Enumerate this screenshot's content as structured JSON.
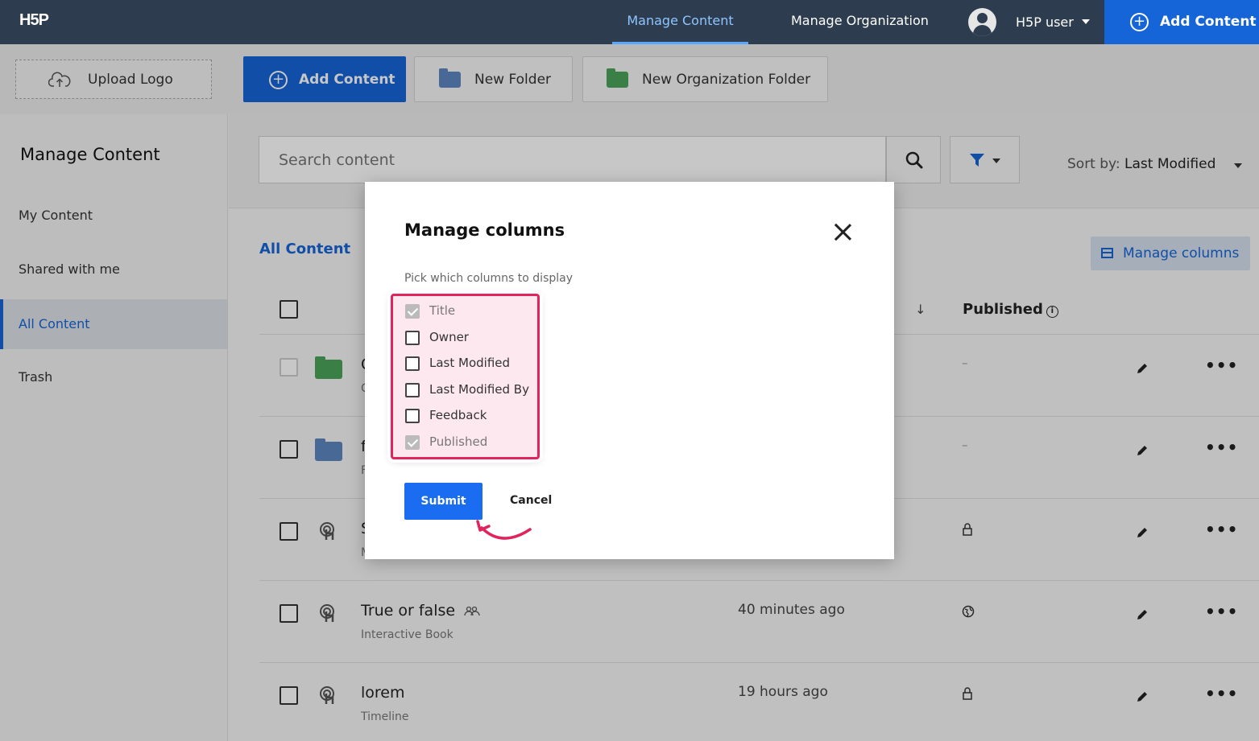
{
  "topbar": {
    "logo": "H5P",
    "nav": [
      "Manage Content",
      "Manage Organization"
    ],
    "user_name": "H5P user",
    "add_content": "Add Content",
    "colors": {
      "bar": "#2d3d4f",
      "accent": "#1565d8"
    }
  },
  "toolbar": {
    "upload_logo": "Upload Logo",
    "add_content": "Add Content",
    "new_folder": "New Folder",
    "new_org_folder": "New Organization Folder"
  },
  "sidebar": {
    "title": "Manage Content",
    "items": [
      "My Content",
      "Shared with me",
      "All Content",
      "Trash"
    ],
    "active_index": 2
  },
  "main": {
    "search_placeholder": "Search content",
    "sort_label": "Sort by:",
    "sort_value": "Last Modified",
    "section_title": "All Content",
    "manage_columns": "Manage columns",
    "col_published": "Published",
    "rows": [
      {
        "title": "C",
        "subtitle": "C",
        "modified": "",
        "published": "–",
        "type": "org-folder"
      },
      {
        "title": "f",
        "subtitle": "F",
        "modified": "",
        "published": "–",
        "type": "folder"
      },
      {
        "title": "S",
        "subtitle": "M",
        "modified": "",
        "published": "lock",
        "type": "content"
      },
      {
        "title": "True or false",
        "subtitle": "Interactive Book",
        "modified": "40 minutes ago",
        "published": "globe",
        "type": "content"
      },
      {
        "title": "lorem",
        "subtitle": "Timeline",
        "modified": "19 hours ago",
        "published": "lock",
        "type": "content"
      }
    ]
  },
  "modal": {
    "title": "Manage columns",
    "subtitle": "Pick which columns to display",
    "options": [
      {
        "label": "Title",
        "checked": true
      },
      {
        "label": "Owner",
        "checked": false
      },
      {
        "label": "Last Modified",
        "checked": false
      },
      {
        "label": "Last Modified By",
        "checked": false
      },
      {
        "label": "Feedback",
        "checked": false
      },
      {
        "label": "Published",
        "checked": true
      }
    ],
    "submit": "Submit",
    "cancel": "Cancel",
    "highlight_color": "#e0245e"
  }
}
